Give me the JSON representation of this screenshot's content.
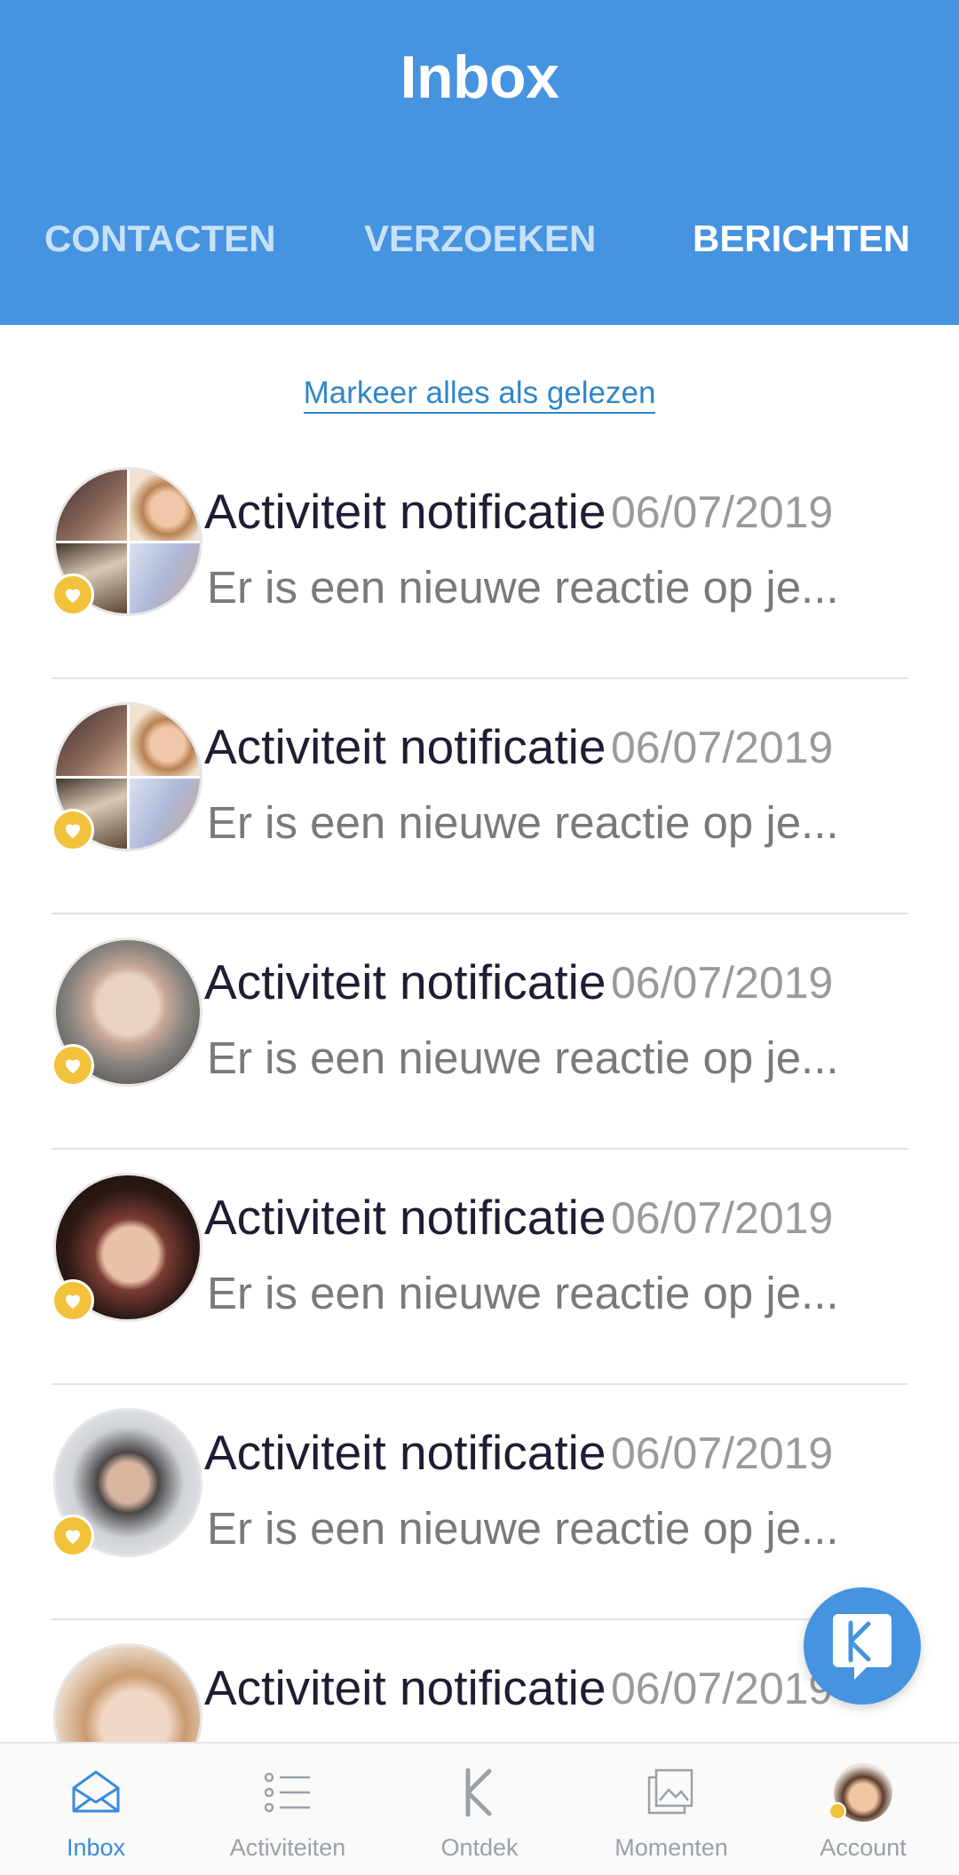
{
  "header": {
    "title": "Inbox",
    "tabs": [
      {
        "label": "CONTACTEN",
        "active": false
      },
      {
        "label": "VERZOEKEN",
        "active": false
      },
      {
        "label": "BERICHTEN",
        "active": true
      }
    ]
  },
  "mark_all_label": "Markeer alles als gelezen",
  "messages": [
    {
      "name": "Activiteit notificatie",
      "date": "06/07/2019",
      "preview": "Er is een nieuwe reactie op je...",
      "avatar": "group-avatar"
    },
    {
      "name": "Activiteit notificatie",
      "date": "06/07/2019",
      "preview": "Er is een nieuwe reactie op je...",
      "avatar": "group-avatar"
    },
    {
      "name": "Activiteit notificatie",
      "date": "06/07/2019",
      "preview": "Er is een nieuwe reactie op je...",
      "avatar": "user-avatar"
    },
    {
      "name": "Activiteit notificatie",
      "date": "06/07/2019",
      "preview": "Er is een nieuwe reactie op je...",
      "avatar": "user-avatar"
    },
    {
      "name": "Activiteit notificatie",
      "date": "06/07/2019",
      "preview": "Er is een nieuwe reactie op je...",
      "avatar": "user-avatar"
    },
    {
      "name": "Activiteit notificatie",
      "date": "06/07/2019",
      "preview": "",
      "avatar": "user-avatar"
    }
  ],
  "bottom_nav": [
    {
      "label": "Inbox",
      "icon": "envelope-icon",
      "active": true
    },
    {
      "label": "Activiteiten",
      "icon": "list-icon",
      "active": false
    },
    {
      "label": "Ontdek",
      "icon": "k-logo-icon",
      "active": false
    },
    {
      "label": "Momenten",
      "icon": "photos-icon",
      "active": false
    },
    {
      "label": "Account",
      "icon": "account-avatar",
      "active": false
    }
  ],
  "colors": {
    "header_bg": "#4693e0",
    "tab_inactive": "#c8e1fa",
    "link": "#2f86c8",
    "badge": "#f2c23b",
    "nav_active": "#3a8bd9"
  }
}
